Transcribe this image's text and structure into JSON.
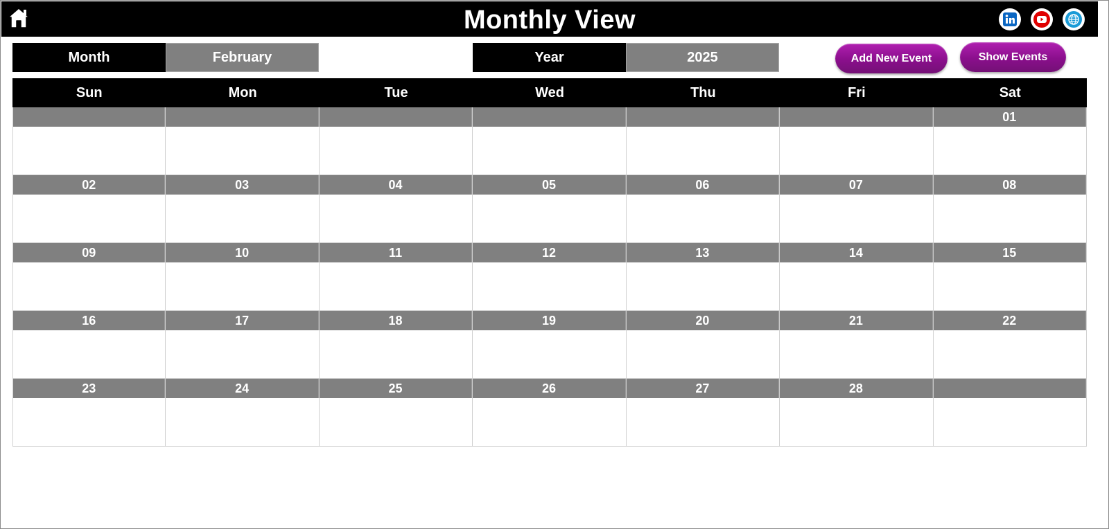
{
  "header": {
    "title": "Monthly View",
    "home_icon": "home-icon",
    "social": [
      {
        "name": "linkedin-icon",
        "glyph": "in",
        "color": "#0a66c2"
      },
      {
        "name": "youtube-icon",
        "glyph": "▶",
        "color": "#e00000"
      },
      {
        "name": "globe-icon",
        "glyph": "⊕",
        "color": "#1a9bd7"
      }
    ]
  },
  "selectors": {
    "month_label": "Month",
    "month_value": "February",
    "year_label": "Year",
    "year_value": "2025"
  },
  "buttons": {
    "add_event": "Add New Event",
    "show_events": "Show Events",
    "accent_color": "#8a0f8c"
  },
  "calendar": {
    "weekdays": [
      "Sun",
      "Mon",
      "Tue",
      "Wed",
      "Thu",
      "Fri",
      "Sat"
    ],
    "weeks": [
      [
        "",
        "",
        "",
        "",
        "",
        "",
        "01"
      ],
      [
        "02",
        "03",
        "04",
        "05",
        "06",
        "07",
        "08"
      ],
      [
        "09",
        "10",
        "11",
        "12",
        "13",
        "14",
        "15"
      ],
      [
        "16",
        "17",
        "18",
        "19",
        "20",
        "21",
        "22"
      ],
      [
        "23",
        "24",
        "25",
        "26",
        "27",
        "28",
        ""
      ]
    ]
  }
}
